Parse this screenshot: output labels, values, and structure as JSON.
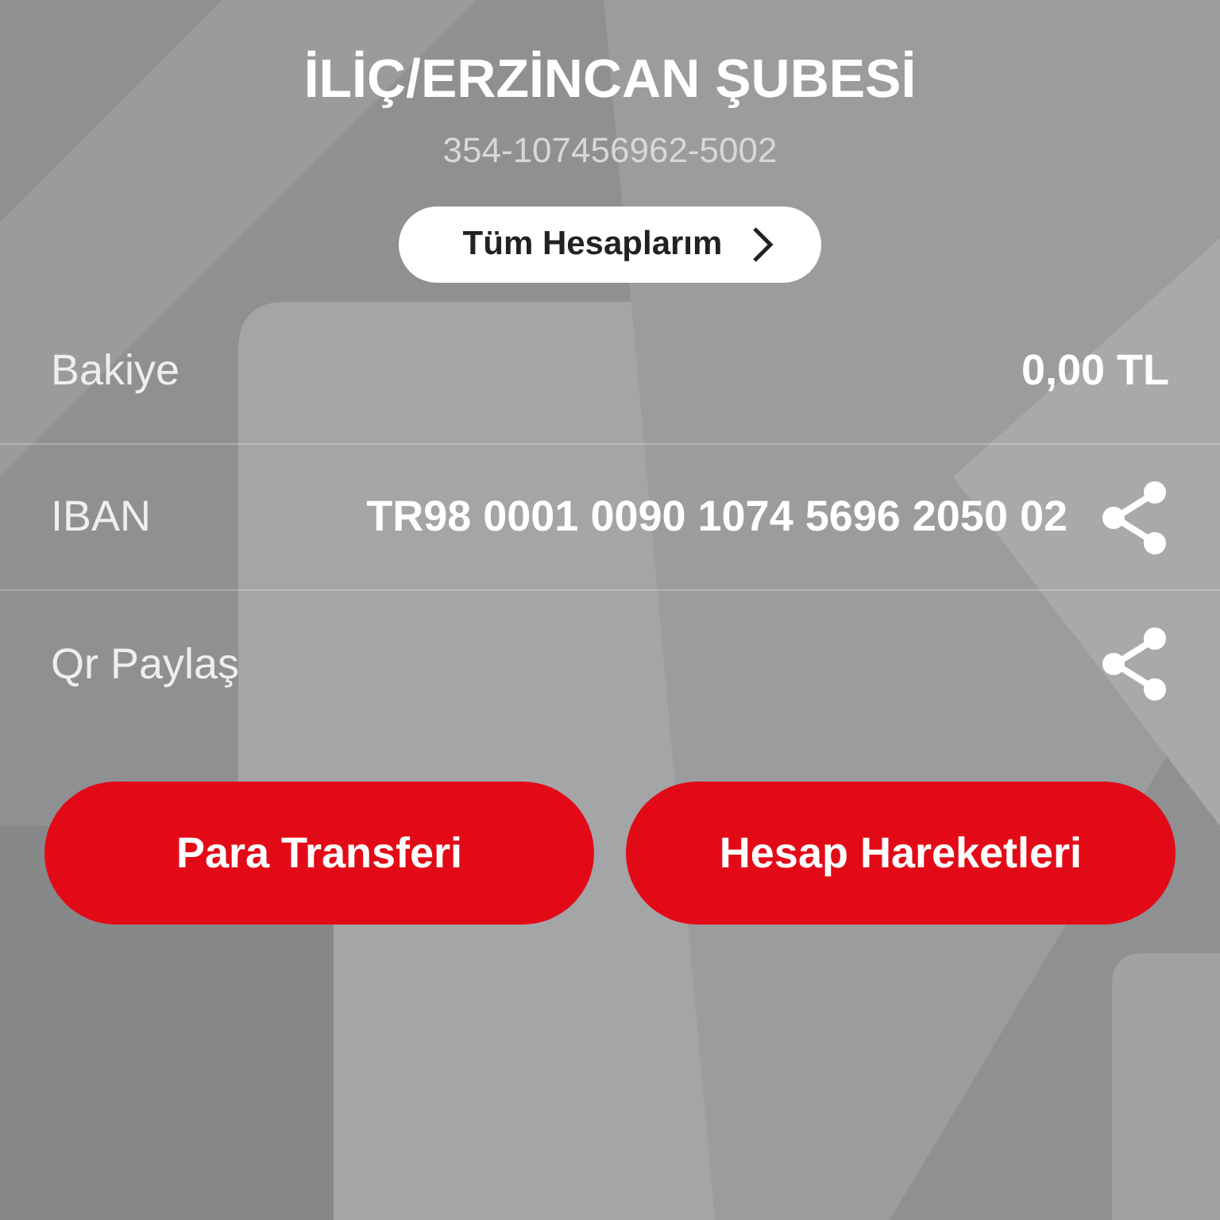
{
  "header": {
    "title": "İLİÇ/ERZİNCAN ŞUBESİ",
    "account_number": "354-107456962-5002"
  },
  "all_accounts_button": {
    "label": "Tüm Hesaplarım"
  },
  "rows": [
    {
      "label": "Bakiye",
      "value": "0,00 TL",
      "share": false
    },
    {
      "label": "IBAN",
      "value": "TR98 0001 0090 1074 5696 2050 02",
      "share": true
    },
    {
      "label": "Qr Paylaş",
      "share": true
    }
  ],
  "buttons": [
    {
      "label": "Para Transferi"
    },
    {
      "label": "Hesap Hareketleri"
    }
  ]
}
